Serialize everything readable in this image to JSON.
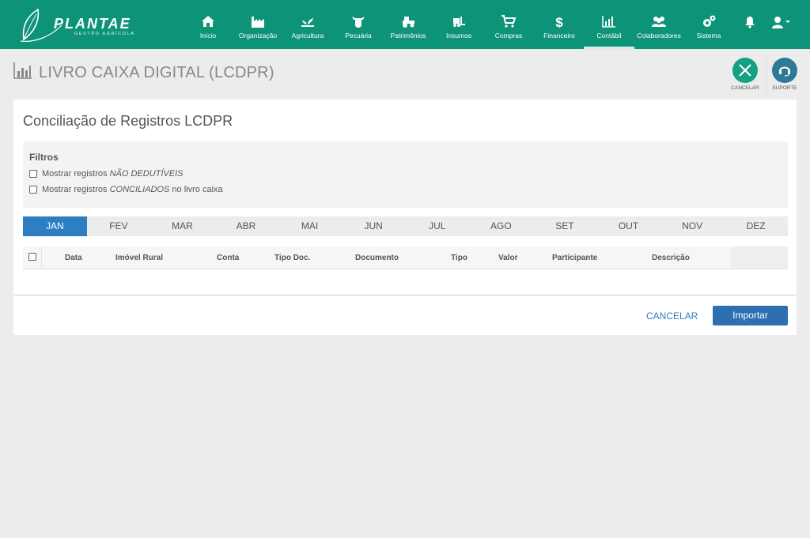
{
  "brand": {
    "name": "PLANTAE",
    "tagline": "GESTÃO AGRÍCOLA"
  },
  "nav": [
    {
      "label": "Início",
      "icon": "home-icon"
    },
    {
      "label": "Organização",
      "icon": "factory-icon"
    },
    {
      "label": "Agricultura",
      "icon": "plant-icon"
    },
    {
      "label": "Pecuária",
      "icon": "cow-icon"
    },
    {
      "label": "Patrimônios",
      "icon": "tractor-icon"
    },
    {
      "label": "Insumos",
      "icon": "forklift-icon"
    },
    {
      "label": "Compras",
      "icon": "cart-icon"
    },
    {
      "label": "Financeiro",
      "icon": "dollar-icon"
    },
    {
      "label": "Contábil",
      "icon": "chart-icon"
    },
    {
      "label": "Colaboradores",
      "icon": "users-icon"
    },
    {
      "label": "Sistema",
      "icon": "gears-icon"
    }
  ],
  "header": {
    "title": "LIVRO CAIXA DIGITAL (LCDPR)",
    "cancel_label": "CANCELAR",
    "support_label": "SUPORTE"
  },
  "card": {
    "title": "Conciliação de Registros LCDPR",
    "filters_title": "Filtros",
    "filter1_prefix": "Mostrar registros ",
    "filter1_em": "NÃO DEDUTÍVEIS",
    "filter2_prefix": "Mostrar registros ",
    "filter2_em": "CONCILIADOS",
    "filter2_suffix": " no livro caixa"
  },
  "months": [
    "JAN",
    "FEV",
    "MAR",
    "ABR",
    "MAI",
    "JUN",
    "JUL",
    "AGO",
    "SET",
    "OUT",
    "NOV",
    "DEZ"
  ],
  "table": {
    "headers": [
      "Data",
      "Imóvel Rural",
      "Conta",
      "Tipo Doc.",
      "Documento",
      "Tipo",
      "Valor",
      "Participante",
      "Descrição"
    ]
  },
  "footer": {
    "cancel_label": "CANCELAR",
    "import_label": "Importar"
  },
  "colors": {
    "brand": "#0d9478",
    "primary": "#2d7fc1"
  }
}
